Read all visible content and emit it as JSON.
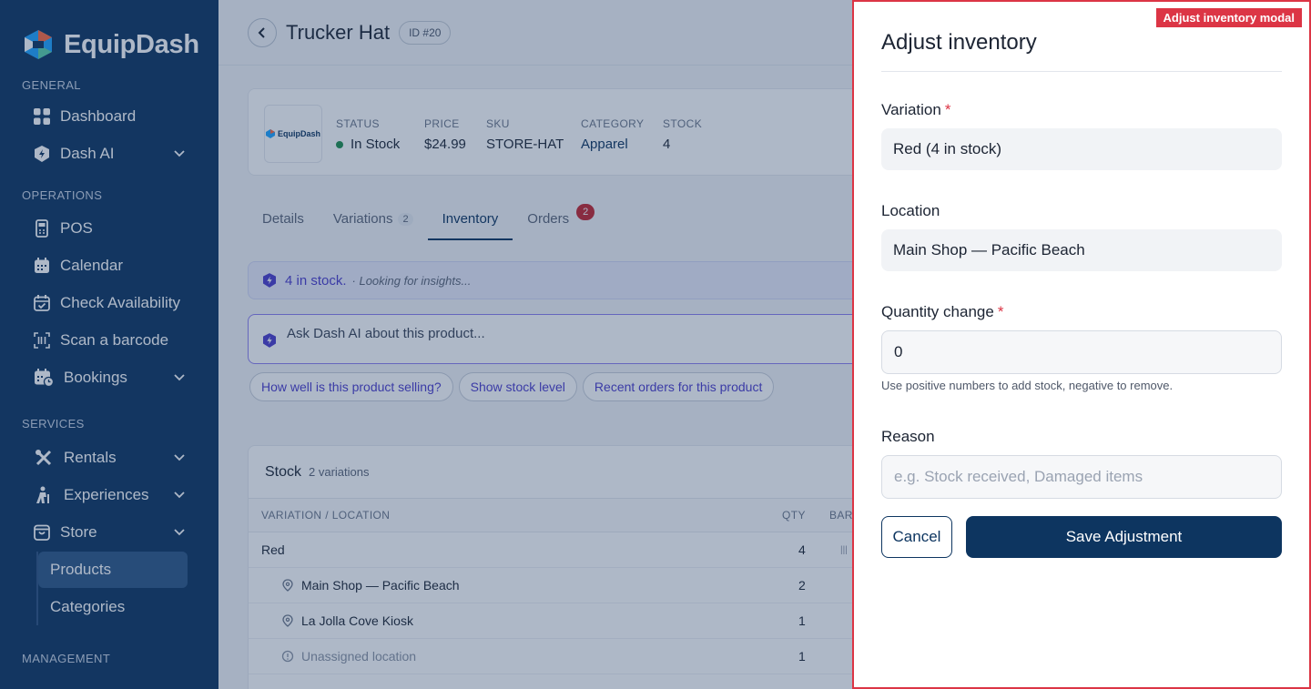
{
  "brand": {
    "name": "EquipDash"
  },
  "sidebar": {
    "general_label": "GENERAL",
    "general": [
      {
        "label": "Dashboard",
        "icon": "grid-icon"
      },
      {
        "label": "Dash AI",
        "icon": "ai-shield-icon"
      }
    ],
    "operations_label": "OPERATIONS",
    "operations": [
      {
        "label": "POS",
        "icon": "pos-terminal-icon"
      },
      {
        "label": "Calendar",
        "icon": "calendar-icon"
      },
      {
        "label": "Check Availability",
        "icon": "calendar-check-icon"
      },
      {
        "label": "Scan a barcode",
        "icon": "barcode-scan-icon"
      },
      {
        "label": "Bookings",
        "icon": "bookings-icon"
      }
    ],
    "services_label": "SERVICES",
    "services": [
      {
        "label": "Rentals",
        "icon": "rentals-icon"
      },
      {
        "label": "Experiences",
        "icon": "experiences-icon"
      },
      {
        "label": "Store",
        "icon": "store-bag-icon"
      }
    ],
    "store_sub": [
      {
        "label": "Products"
      },
      {
        "label": "Categories"
      }
    ],
    "management_label": "MANAGEMENT"
  },
  "product": {
    "title": "Trucker Hat",
    "id_badge": "ID #20",
    "logo_text": "EquipDash",
    "status_label": "STATUS",
    "status_value": "In Stock",
    "price_label": "PRICE",
    "price_value": "$24.99",
    "sku_label": "SKU",
    "sku_value": "STORE-HAT",
    "category_label": "CATEGORY",
    "category_value": "Apparel",
    "stock_label": "STOCK",
    "stock_value": "4"
  },
  "tabs": [
    {
      "label": "Details"
    },
    {
      "label": "Variations",
      "count": "2"
    },
    {
      "label": "Inventory",
      "active": true
    },
    {
      "label": "Orders",
      "badge": "2"
    }
  ],
  "ai": {
    "banner_text": "4 in stock.",
    "banner_sub": "· Looking for insights...",
    "input_placeholder": "Ask Dash AI about this product...",
    "chips": [
      "How well is this product selling?",
      "Show stock level",
      "Recent orders for this product"
    ]
  },
  "stock": {
    "title": "Stock",
    "sub": "2 variations",
    "col_variation": "VARIATION / LOCATION",
    "col_qty": "QTY",
    "col_bar": "BAR",
    "rows": [
      {
        "name": "Red",
        "qty": "4"
      },
      {
        "name": "Main Shop — Pacific Beach",
        "qty": "2"
      },
      {
        "name": "La Jolla Cove Kiosk",
        "qty": "1"
      },
      {
        "name": "Unassigned location",
        "qty": "1"
      }
    ]
  },
  "modal": {
    "tag": "Adjust inventory modal",
    "title": "Adjust inventory",
    "variation_label": "Variation",
    "variation_value": "Red (4 in stock)",
    "location_label": "Location",
    "location_value": "Main Shop — Pacific Beach",
    "quantity_label": "Quantity change",
    "quantity_value": "0",
    "quantity_help": "Use positive numbers to add stock, negative to remove.",
    "reason_label": "Reason",
    "reason_placeholder": "e.g. Stock received, Damaged items",
    "required_mark": "*",
    "cancel_label": "Cancel",
    "save_label": "Save Adjustment"
  },
  "colors": {
    "sidebar": "#0d3560",
    "accent": "#0d3560",
    "danger": "#dc3545",
    "ai": "#4b3ccc",
    "success": "#1f8f4e"
  }
}
